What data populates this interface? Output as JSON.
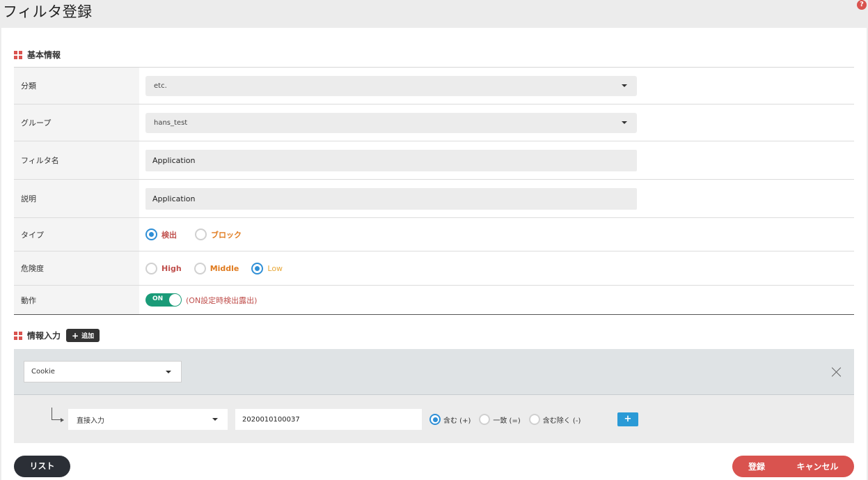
{
  "page": {
    "title": "フィルタ登録",
    "help_icon": "?"
  },
  "basic_info": {
    "heading": "基本情報",
    "rows": {
      "category": {
        "label": "分類",
        "value": "etc."
      },
      "group": {
        "label": "グループ",
        "value": "hans_test"
      },
      "filter_name": {
        "label": "フィルタ名",
        "value": "Application"
      },
      "description": {
        "label": "説明",
        "value": "Application"
      },
      "type": {
        "label": "タイプ",
        "options": [
          "検出",
          "ブロック"
        ],
        "selected": "検出"
      },
      "risk": {
        "label": "危険度",
        "options": [
          "High",
          "Middle",
          "Low"
        ],
        "selected": "Low"
      },
      "action": {
        "label": "動作",
        "toggle_label": "ON",
        "toggle_on": true,
        "note": "(ON設定時検出露出)"
      }
    }
  },
  "info_input": {
    "heading": "情報入力",
    "add_button": {
      "icon": "+",
      "label": "追加"
    },
    "target_select": "Cookie",
    "method_select": "直接入力",
    "value": "2020010100037",
    "match_options": [
      "含む (+)",
      "一致 (=)",
      "含む除く (-)"
    ],
    "match_selected": "含む (+)",
    "add_condition_icon": "+"
  },
  "footer": {
    "list_label": "リスト",
    "register_label": "登録",
    "cancel_label": "キャンセル"
  },
  "colors": {
    "accent_red": "#d9534f",
    "toggle_green": "#1a9b78",
    "radio_blue": "#2f8fd6",
    "plus_blue": "#2a9ad6"
  }
}
